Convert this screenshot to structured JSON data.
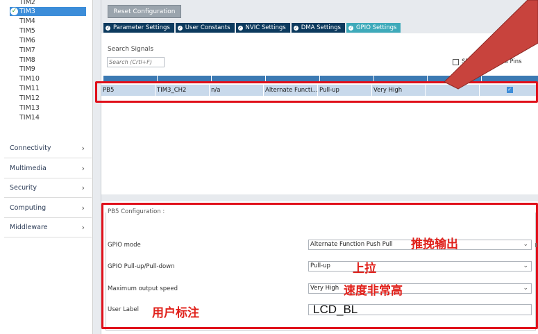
{
  "sidebar": {
    "tim_items": [
      "TIM2",
      "TIM3",
      "TIM4",
      "TIM5",
      "TIM6",
      "TIM7",
      "TIM8",
      "TIM9",
      "TIM10",
      "TIM11",
      "TIM12",
      "TIM13",
      "TIM14"
    ],
    "selected": "TIM3",
    "categories": [
      "Connectivity",
      "Multimedia",
      "Security",
      "Computing",
      "Middleware"
    ]
  },
  "toolbar": {
    "reset_label": "Reset Configuration"
  },
  "tabs": [
    "Parameter Settings",
    "User Constants",
    "NVIC Settings",
    "DMA Settings",
    "GPIO Settings"
  ],
  "active_tab": "GPIO Settings",
  "search": {
    "label": "Search Signals",
    "placeholder": "Search (Crtl+F)"
  },
  "show_modified": {
    "label": "Sh          odified Pins",
    "checked": false
  },
  "table": {
    "row": [
      "PB5",
      "TIM3_CH2",
      "n/a",
      "Alternate Functi...",
      "Pull-up",
      "Very High",
      "",
      ""
    ],
    "modified": true
  },
  "config": {
    "title": "PB5 Configuration :",
    "fields": [
      {
        "label": "GPIO mode",
        "value": "Alternate Function Push Pull"
      },
      {
        "label": "GPIO Pull-up/Pull-down",
        "value": "Pull-up"
      },
      {
        "label": "Maximum output speed",
        "value": "Very High"
      },
      {
        "label": "User Label",
        "value": "LCD_BL"
      }
    ]
  },
  "annotations": [
    "推挽输出",
    "上拉",
    "速度非常高",
    "用户标注"
  ],
  "colors": {
    "accent": "#3c8dd9",
    "tab_dark": "#0c3a5e",
    "tab_active": "#3eaaba",
    "annotation_red": "#e0201a"
  }
}
